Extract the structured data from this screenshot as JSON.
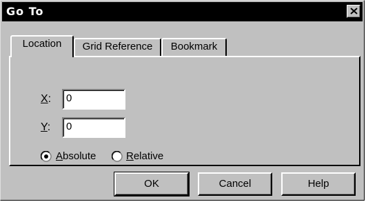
{
  "window": {
    "title": "Go To"
  },
  "tabs": [
    {
      "label": "Location",
      "active": true
    },
    {
      "label": "Grid Reference",
      "active": false
    },
    {
      "label": "Bookmark",
      "active": false
    }
  ],
  "fields": {
    "x": {
      "mnemonic": "X",
      "rest": ":",
      "value": "0"
    },
    "y": {
      "mnemonic": "Y",
      "rest": ":",
      "value": "0"
    }
  },
  "mode": {
    "absolute": {
      "mnemonic": "A",
      "rest": "bsolute",
      "selected": true
    },
    "relative": {
      "mnemonic": "R",
      "rest": "elative",
      "selected": false
    }
  },
  "buttons": {
    "ok": "OK",
    "cancel": "Cancel",
    "help": "Help"
  },
  "icons": {
    "close": "close-icon",
    "radio_on": "radio-selected-icon",
    "radio_off": "radio-unselected-icon"
  }
}
